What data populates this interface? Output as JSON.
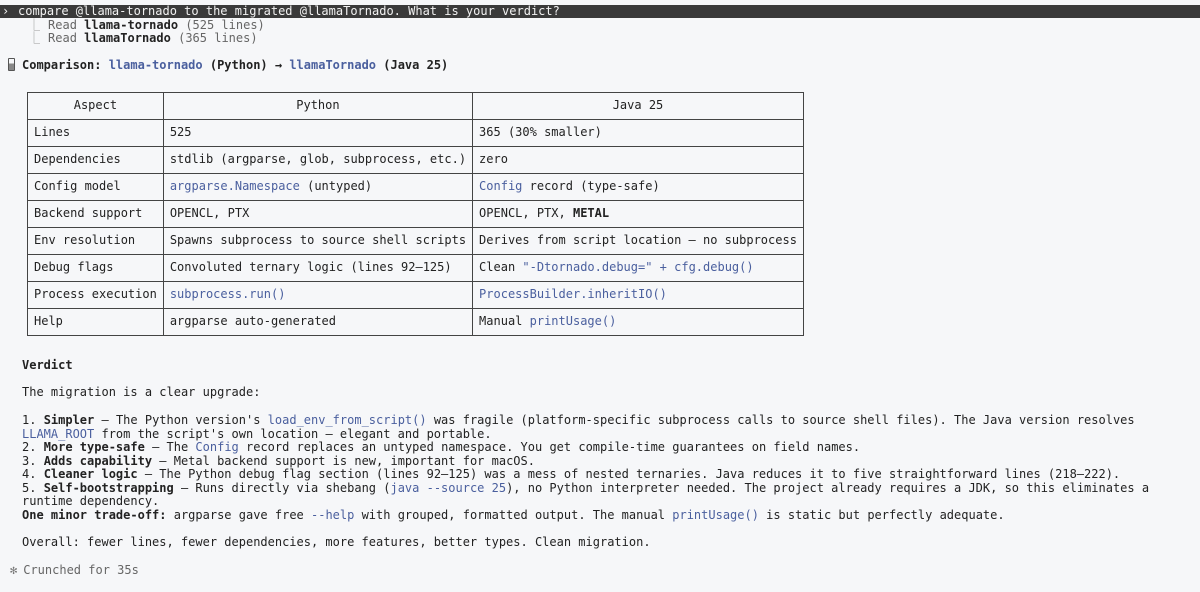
{
  "prompt": {
    "chevron": "›",
    "text": "compare @llama-tornado to the migrated @llamaTornado. What is your verdict?"
  },
  "tool_calls": [
    {
      "verb": "Read",
      "file": "llama-tornado",
      "detail": "(525 lines)"
    },
    {
      "verb": "Read",
      "file": "llamaTornado",
      "detail": "(365 lines)"
    }
  ],
  "heading": {
    "prefix": "Comparison: ",
    "left_name": "llama-tornado",
    "left_lang": " (Python) → ",
    "right_name": "llamaTornado",
    "right_lang": " (Java 25)"
  },
  "table": {
    "headers": [
      "Aspect",
      "Python",
      "Java 25"
    ],
    "rows": [
      {
        "aspect": "Lines",
        "py": [
          {
            "t": "525"
          }
        ],
        "java": [
          {
            "t": "365 (30% smaller)"
          }
        ]
      },
      {
        "aspect": "Dependencies",
        "py": [
          {
            "t": "stdlib (argparse, glob, subprocess, etc.)"
          }
        ],
        "java": [
          {
            "t": "zero"
          }
        ]
      },
      {
        "aspect": "Config model",
        "py": [
          {
            "t": "argparse.Namespace",
            "c": 1
          },
          {
            "t": " (untyped)"
          }
        ],
        "java": [
          {
            "t": "Config",
            "c": 1
          },
          {
            "t": " record (type-safe)"
          }
        ]
      },
      {
        "aspect": "Backend support",
        "py": [
          {
            "t": "OPENCL, PTX"
          }
        ],
        "java": [
          {
            "t": "OPENCL, PTX, "
          },
          {
            "t": "METAL",
            "b": 1
          }
        ]
      },
      {
        "aspect": "Env resolution",
        "py": [
          {
            "t": "Spawns subprocess to source shell scripts"
          }
        ],
        "java": [
          {
            "t": "Derives from script location — no subprocess"
          }
        ]
      },
      {
        "aspect": "Debug flags",
        "py": [
          {
            "t": "Convoluted ternary logic (lines 92–125)"
          }
        ],
        "java": [
          {
            "t": "Clean "
          },
          {
            "t": "\"-Dtornado.debug=\" + cfg.debug()",
            "c": 1
          }
        ]
      },
      {
        "aspect": "Process execution",
        "py": [
          {
            "t": "subprocess.run()",
            "c": 1
          }
        ],
        "java": [
          {
            "t": "ProcessBuilder.inheritIO()",
            "c": 1
          }
        ]
      },
      {
        "aspect": "Help",
        "py": [
          {
            "t": "argparse auto-generated"
          }
        ],
        "java": [
          {
            "t": "Manual "
          },
          {
            "t": "printUsage()",
            "c": 1
          }
        ]
      }
    ]
  },
  "verdict": {
    "heading": "Verdict",
    "intro": "The migration is a clear upgrade:",
    "points": [
      [
        {
          "t": "1. "
        },
        {
          "t": "Simpler",
          "b": 1
        },
        {
          "t": " — The Python version's "
        },
        {
          "t": "load_env_from_script()",
          "c": 1
        },
        {
          "t": " was fragile (platform-specific subprocess calls to source shell files). The Java version resolves "
        },
        {
          "t": "LLAMA_ROOT",
          "c": 1
        },
        {
          "t": " from the script's own location — elegant and portable."
        }
      ],
      [
        {
          "t": "2. "
        },
        {
          "t": "More type-safe",
          "b": 1
        },
        {
          "t": " — The "
        },
        {
          "t": "Config",
          "c": 1
        },
        {
          "t": " record replaces an untyped namespace. You get compile-time guarantees on field names."
        }
      ],
      [
        {
          "t": "3. "
        },
        {
          "t": "Adds capability",
          "b": 1
        },
        {
          "t": " — Metal backend support is new, important for macOS."
        }
      ],
      [
        {
          "t": "4. "
        },
        {
          "t": "Cleaner logic",
          "b": 1
        },
        {
          "t": " — The Python debug flag section (lines 92–125) was a mess of nested ternaries. Java reduces it to five straightforward lines (218–222)."
        }
      ],
      [
        {
          "t": "5. "
        },
        {
          "t": "Self-bootstrapping",
          "b": 1
        },
        {
          "t": " — Runs directly via shebang ("
        },
        {
          "t": "java --source 25",
          "c": 1
        },
        {
          "t": "), no Python interpreter needed. The project already requires a JDK, so this eliminates a runtime dependency."
        }
      ]
    ],
    "tradeoff": [
      {
        "t": "One minor trade-off:",
        "b": 1
      },
      {
        "t": " argparse gave free "
      },
      {
        "t": "--help",
        "c": 1
      },
      {
        "t": " with grouped, formatted output. The manual "
      },
      {
        "t": "printUsage()",
        "c": 1
      },
      {
        "t": " is static but perfectly adequate."
      }
    ],
    "overall": "Overall: fewer lines, fewer dependencies, more features, better types. Clean migration."
  },
  "footer": {
    "star": "✻",
    "text": "Crunched for 35s"
  }
}
